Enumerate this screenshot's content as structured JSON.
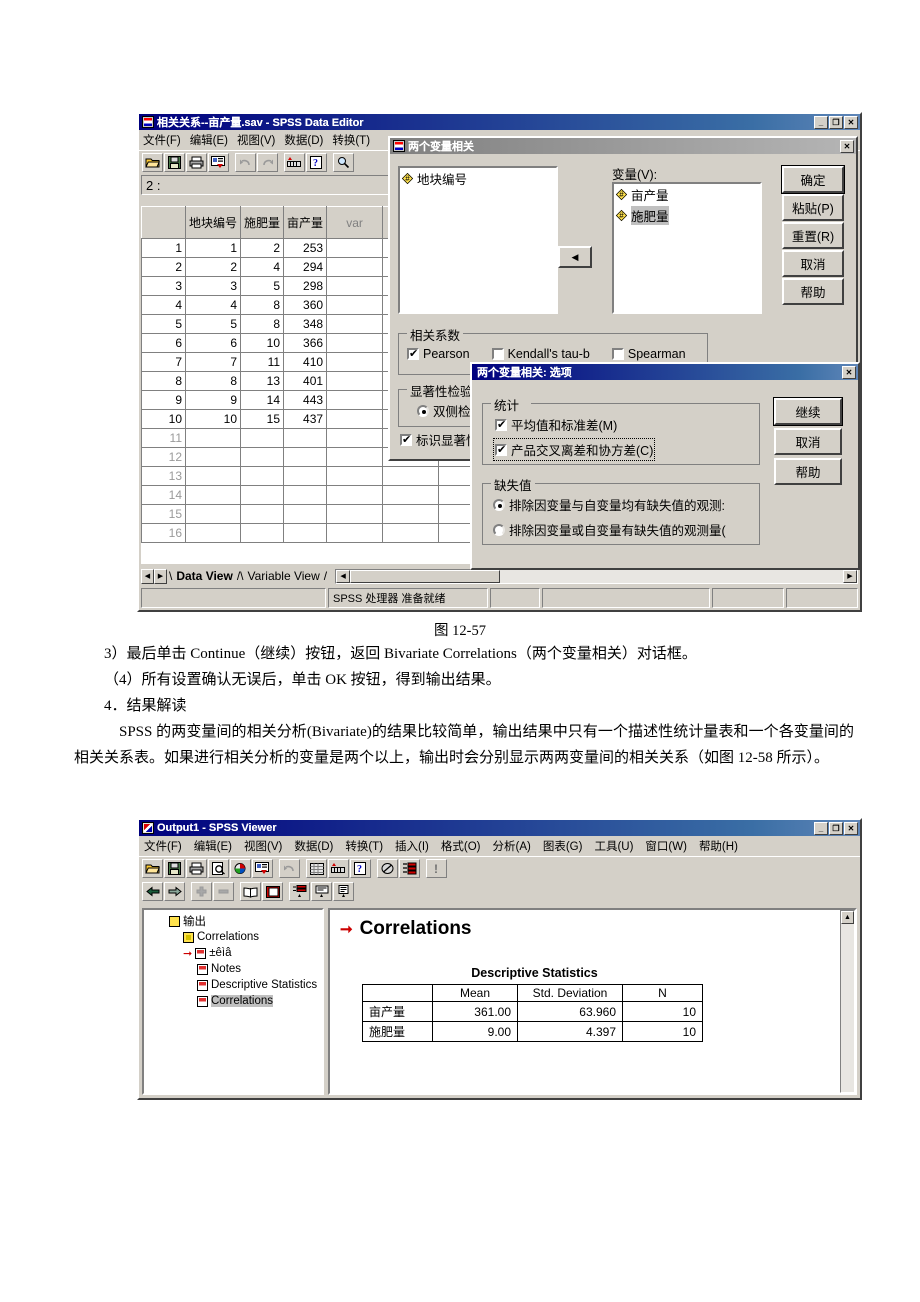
{
  "data_editor": {
    "title": "相关关系--亩产量.sav - SPSS Data Editor",
    "menus": [
      "文件(F)",
      "编辑(E)",
      "视图(V)",
      "数据(D)",
      "转换(T)"
    ],
    "cell_ref": "2 :",
    "columns": [
      "地块编号",
      "施肥量",
      "亩产量",
      "var",
      ""
    ],
    "rows": [
      {
        "n": "1",
        "c1": "1",
        "c2": "2",
        "c3": "253"
      },
      {
        "n": "2",
        "c1": "2",
        "c2": "4",
        "c3": "294"
      },
      {
        "n": "3",
        "c1": "3",
        "c2": "5",
        "c3": "298"
      },
      {
        "n": "4",
        "c1": "4",
        "c2": "8",
        "c3": "360"
      },
      {
        "n": "5",
        "c1": "5",
        "c2": "8",
        "c3": "348"
      },
      {
        "n": "6",
        "c1": "6",
        "c2": "10",
        "c3": "366"
      },
      {
        "n": "7",
        "c1": "7",
        "c2": "11",
        "c3": "410"
      },
      {
        "n": "8",
        "c1": "8",
        "c2": "13",
        "c3": "401"
      },
      {
        "n": "9",
        "c1": "9",
        "c2": "14",
        "c3": "443"
      },
      {
        "n": "10",
        "c1": "10",
        "c2": "15",
        "c3": "437"
      }
    ],
    "empty_rows": [
      "11",
      "12",
      "13",
      "14",
      "15",
      "16"
    ],
    "tab_data_view": "Data View",
    "tab_variable_view": "Variable View",
    "status": "SPSS 处理器 准备就绪"
  },
  "bivariate_dialog": {
    "title": "两个变量相关",
    "source_vars": [
      "地块编号"
    ],
    "target_label": "变量(V):",
    "target_vars": [
      "亩产量",
      "施肥量"
    ],
    "selected_target": "施肥量",
    "buttons": [
      "确定",
      "粘贴(P)",
      "重置(R)",
      "取消",
      "帮助"
    ],
    "coef_group": "相关系数",
    "coef_pearson": "Pearson",
    "coef_kendall": "Kendall's tau-b",
    "coef_spearman": "Spearman",
    "sig_group": "显著性检验",
    "sig_two_tailed": "双侧检验",
    "flag_sig": "标识显著性相关"
  },
  "options_dialog": {
    "title": "两个变量相关: 选项",
    "stats_group": "统计",
    "stat_mean_sd": "平均值和标准差(M)",
    "stat_cross": "产品交叉离差和协方差(C)",
    "missing_group": "缺失值",
    "missing_pairwise": "排除因变量与自变量均有缺失值的观测:",
    "missing_listwise": "排除因变量或自变量有缺失值的观测量(",
    "buttons": [
      "继续",
      "取消",
      "帮助"
    ]
  },
  "figure_caption": "图 12-57",
  "body": {
    "p1": "3）最后单击 Continue（继续）按钮，返回 Bivariate Correlations（两个变量相关）对话框。",
    "p2": "（4）所有设置确认无误后，单击 OK 按钮，得到输出结果。",
    "p3": "4．结果解读",
    "p4": "SPSS 的两变量间的相关分析(Bivariate)的结果比较简单，输出结果中只有一个描述性统计量表和一个各变量间的相关关系表。如果进行相关分析的变量是两个以上，输出时会分别显示两两变量间的相关关系（如图 12-58 所示）。"
  },
  "viewer": {
    "title": "Output1 - SPSS Viewer",
    "menus": [
      "文件(F)",
      "编辑(E)",
      "视图(V)",
      "数据(D)",
      "转换(T)",
      "插入(I)",
      "格式(O)",
      "分析(A)",
      "图表(G)",
      "工具(U)",
      "窗口(W)",
      "帮助(H)"
    ],
    "tree": [
      {
        "label": "输出",
        "indent": 0,
        "icon": "output-root-icon",
        "selected": false,
        "arrow": false
      },
      {
        "label": "Correlations",
        "indent": 1,
        "icon": "log-icon",
        "selected": false,
        "arrow": false
      },
      {
        "label": "±êìâ",
        "indent": 2,
        "icon": "title-icon",
        "selected": false,
        "arrow": true
      },
      {
        "label": "Notes",
        "indent": 2,
        "icon": "notes-icon",
        "selected": false,
        "arrow": false
      },
      {
        "label": "Descriptive Statistics",
        "indent": 2,
        "icon": "table-icon",
        "selected": false,
        "arrow": false
      },
      {
        "label": "Correlations",
        "indent": 2,
        "icon": "table-icon",
        "selected": true,
        "arrow": false
      }
    ],
    "output_heading": "Correlations"
  },
  "chart_data": {
    "type": "table",
    "title": "Descriptive Statistics",
    "columns": [
      "",
      "Mean",
      "Std. Deviation",
      "N"
    ],
    "rows": [
      {
        "label": "亩产量",
        "mean": "361.00",
        "sd": "63.960",
        "n": "10"
      },
      {
        "label": "施肥量",
        "mean": "9.00",
        "sd": "4.397",
        "n": "10"
      }
    ]
  }
}
